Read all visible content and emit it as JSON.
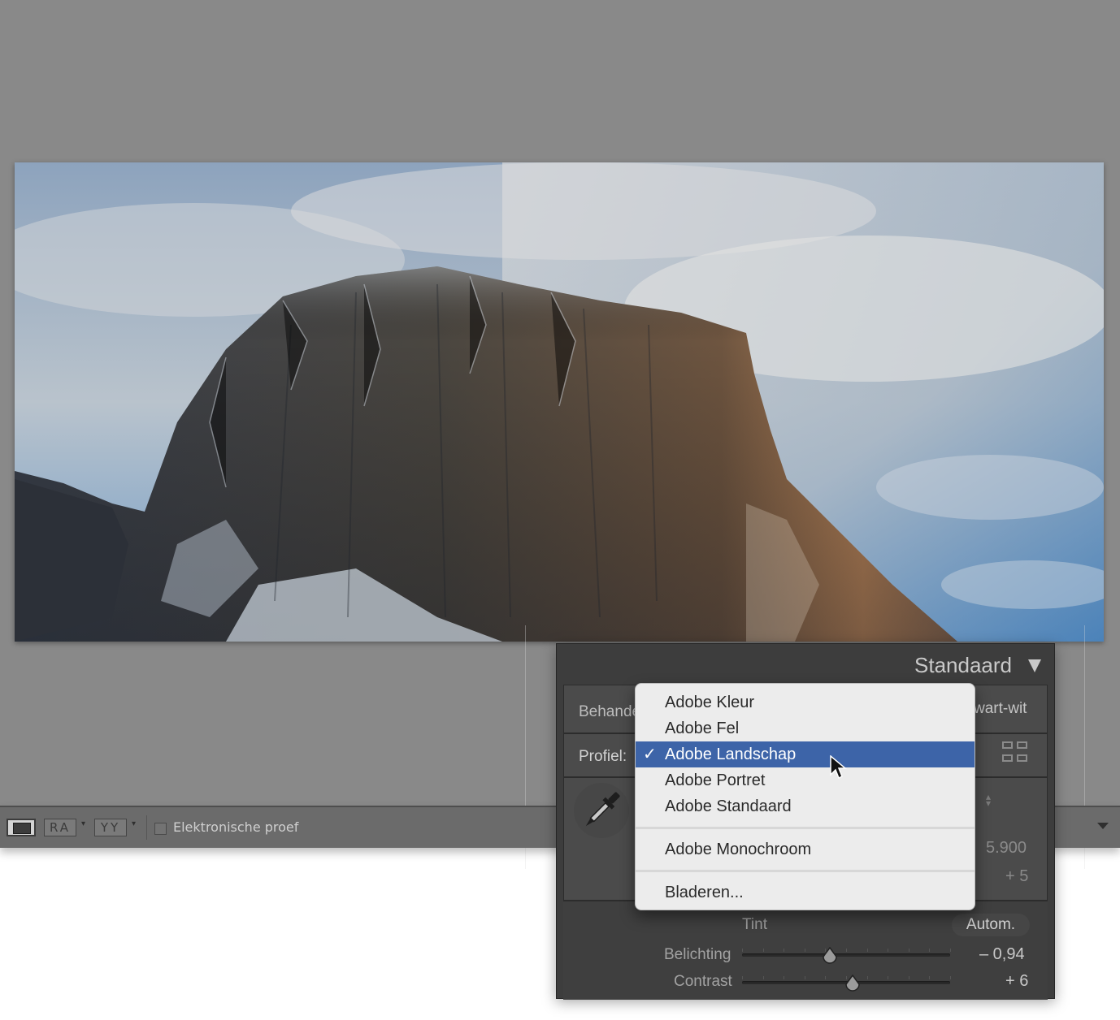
{
  "toolbar": {
    "ra_label": "RA",
    "yy_label": "YY",
    "soft_proof_label": "Elektronische proef",
    "soft_proof_checked": false
  },
  "panel": {
    "preset": "Standaard",
    "treatment_label": "Behandeling:",
    "treatment_visible_prefix": "Behande",
    "treatment_bw_visible": "wart-wit",
    "profile_label": "Profiel:",
    "temp_value": "5.900",
    "tint_value": "+ 5",
    "tint_label": "Tint",
    "auto_label": "Autom.",
    "exposure_label": "Belichting",
    "exposure_value": "– 0,94",
    "exposure_level": 0.42,
    "contrast_label": "Contrast",
    "contrast_value": "+ 6",
    "contrast_level": 0.53
  },
  "profile_menu": {
    "items": [
      {
        "label": "Adobe Kleur",
        "selected": false
      },
      {
        "label": "Adobe Fel",
        "selected": false
      },
      {
        "label": "Adobe Landschap",
        "selected": true
      },
      {
        "label": "Adobe Portret",
        "selected": false
      },
      {
        "label": "Adobe Standaard",
        "selected": false
      },
      {
        "label": "Adobe Monochroom",
        "selected": false
      },
      {
        "label": "Bladeren...",
        "selected": false
      }
    ],
    "check_glyph": "✓",
    "highlight_color": "#3d64a8"
  },
  "colors": {
    "workspace_bg": "#898989",
    "panel_bg": "#3d3d3d",
    "menu_bg": "#ececec"
  }
}
